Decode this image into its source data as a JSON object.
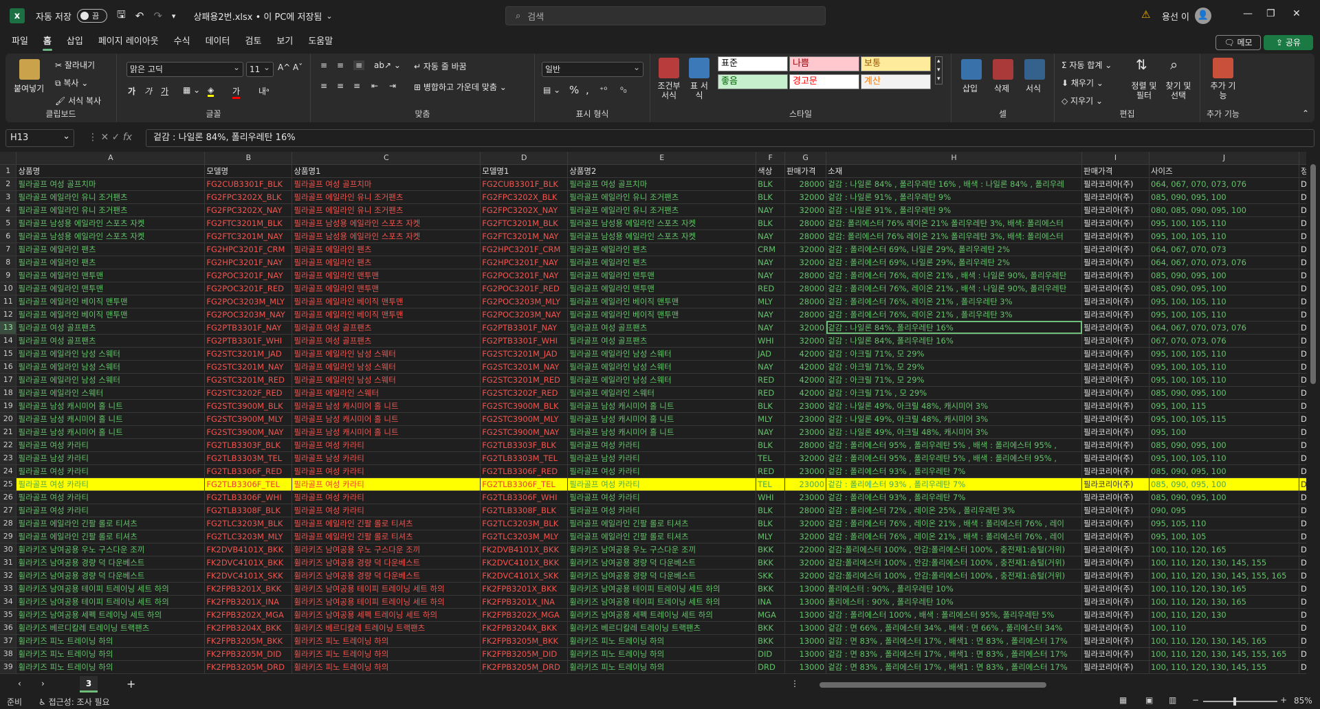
{
  "titlebar": {
    "autosave_label": "자동 저장",
    "autosave_state": "끔",
    "filename": "상패용2번.xlsx • 이 PC에 저장됨",
    "search_placeholder": "검색",
    "username": "용선 이"
  },
  "menu": {
    "tabs": [
      "파일",
      "홈",
      "삽입",
      "페이지 레이아웃",
      "수식",
      "데이터",
      "검토",
      "보기",
      "도움말"
    ],
    "active": "홈",
    "memo": "메모",
    "share": "공유"
  },
  "ribbon": {
    "clipboard": {
      "paste": "붙여넣기",
      "cut": "잘라내기",
      "copy": "복사",
      "format_painter": "서식 복사",
      "label": "클립보드"
    },
    "font": {
      "name": "맑은 고딕",
      "size": "11",
      "label": "글꼴"
    },
    "alignment": {
      "wrap": "자동 줄 바꿈",
      "merge": "병합하고 가운데 맞춤",
      "label": "맞춤"
    },
    "number": {
      "format": "일반",
      "label": "표시 형식"
    },
    "styles": {
      "conditional": "조건부 서식",
      "table": "표 서식",
      "cells": [
        "표준",
        "나쁨",
        "보통",
        "좋음",
        "경고문",
        "계산"
      ],
      "label": "스타일"
    },
    "cells": {
      "insert": "삽입",
      "delete": "삭제",
      "format": "서식",
      "label": "셀"
    },
    "editing": {
      "autosum": "자동 합계",
      "fill": "채우기",
      "clear": "지우기",
      "sort": "정렬 및 필터",
      "find": "찾기 및 선택",
      "label": "편집"
    },
    "addins": {
      "button": "추가 기능",
      "label": "추가 기능"
    }
  },
  "formula_bar": {
    "name_box": "H13",
    "formula": "겉감 : 나일론 84%, 폴리우레탄 16%"
  },
  "grid": {
    "columns": [
      "A",
      "B",
      "C",
      "D",
      "E",
      "F",
      "G",
      "H",
      "I",
      "J"
    ],
    "header_row": [
      "상품명",
      "모델명",
      "상품명1",
      "모델명1",
      "상품명2",
      "색상",
      "판매가격",
      "소재",
      "판매가격",
      "사이즈"
    ],
    "rows": [
      [
        "필라골프 여성 골프치마",
        "FG2CUB3301F_BLK",
        "필라골프 여성 골프치마",
        "FG2CUB3301F_BLK",
        "필라골프 여성 골프치마",
        "BLK",
        "28000",
        "겉감 : 나일론 84% , 폴리우레탄 16% , 배색 : 나일론 84% , 폴리우레",
        "필라코리아(주)",
        "064, 067, 070, 073, 076"
      ],
      [
        "필라골프 에일라인 유니 조거팬츠",
        "FG2FPC3202X_BLK",
        "필라골프 에일라인 유니 조거팬츠",
        "FG2FPC3202X_BLK",
        "필라골프 에일라인 유니 조거팬츠",
        "BLK",
        "32000",
        "겉감 : 나일론 91% , 폴리우레탄 9%",
        "필라코리아(주)",
        "085, 090, 095, 100"
      ],
      [
        "필라골프 에일라인 유니 조거팬츠",
        "FG2FPC3202X_NAY",
        "필라골프 에일라인 유니 조거팬츠",
        "FG2FPC3202X_NAY",
        "필라골프 에일라인 유니 조거팬츠",
        "NAY",
        "32000",
        "겉감 : 나일론 91% , 폴리우레탄 9%",
        "필라코리아(주)",
        "080, 085, 090, 095, 100"
      ],
      [
        "필라골프 남성용 에일라인 스포츠 자켓",
        "FG2FTC3201M_BLK",
        "필라골프 남성용 에일라인 스포츠 자켓",
        "FG2FTC3201M_BLK",
        "필라골프 남성용 에일라인 스포츠 자켓",
        "BLK",
        "28000",
        "겉감: 폴리에스터 76% 레이온 21% 폴리우레탄 3%, 배색: 폴리에스터",
        "필라코리아(주)",
        "095, 100, 105, 110"
      ],
      [
        "필라골프 남성용 에일라인 스포츠 자켓",
        "FG2FTC3201M_NAY",
        "필라골프 남성용 에일라인 스포츠 자켓",
        "FG2FTC3201M_NAY",
        "필라골프 남성용 에일라인 스포츠 자켓",
        "NAY",
        "28000",
        "겉감: 폴리에스터 76% 레이온 21% 폴리우레탄 3%, 배색: 폴리에스터",
        "필라코리아(주)",
        "095, 100, 105, 110"
      ],
      [
        "필라골프 에일라인 팬츠",
        "FG2HPC3201F_CRM",
        "필라골프 에일라인 팬츠",
        "FG2HPC3201F_CRM",
        "필라골프 에일라인 팬츠",
        "CRM",
        "32000",
        "겉감 : 폴리에스터 69%, 나일론 29%, 폴리우레탄 2%",
        "필라코리아(주)",
        "064, 067, 070, 073"
      ],
      [
        "필라골프 에일라인 팬츠",
        "FG2HPC3201F_NAY",
        "필라골프 에일라인 팬츠",
        "FG2HPC3201F_NAY",
        "필라골프 에일라인 팬츠",
        "NAY",
        "32000",
        "겉감 : 폴리에스터 69%, 나일론 29%, 폴리우레탄 2%",
        "필라코리아(주)",
        "064, 067, 070, 073, 076"
      ],
      [
        "필라골프 에일라인 맨투맨",
        "FG2POC3201F_NAY",
        "필라골프 에일라인 맨투맨",
        "FG2POC3201F_NAY",
        "필라골프 에일라인 맨투맨",
        "NAY",
        "28000",
        "겉감 : 폴리에스터 76%, 레이온 21% , 배색 : 나일론 90%, 폴리우레탄",
        "필라코리아(주)",
        "085, 090, 095, 100"
      ],
      [
        "필라골프 에일라인 맨투맨",
        "FG2POC3201F_RED",
        "필라골프 에일라인 맨투맨",
        "FG2POC3201F_RED",
        "필라골프 에일라인 맨투맨",
        "RED",
        "28000",
        "겉감 : 폴리에스터 76%, 레이온 21% , 배색 : 나일론 90%, 폴리우레탄",
        "필라코리아(주)",
        "085, 090, 095, 100"
      ],
      [
        "필라골프 에일라인 베이직 맨투맨",
        "FG2POC3203M_MLY",
        "필라골프 에일라인 베이직 맨투맨",
        "FG2POC3203M_MLY",
        "필라골프 에일라인 베이직 맨투맨",
        "MLY",
        "28000",
        "겉감 : 폴리에스터 76%, 레이온 21% , 폴리우레탄 3%",
        "필라코리아(주)",
        "095, 100, 105, 110"
      ],
      [
        "필라골프 에일라인 베이직 맨투맨",
        "FG2POC3203M_NAY",
        "필라골프 에일라인 베이직 맨투맨",
        "FG2POC3203M_NAY",
        "필라골프 에일라인 베이직 맨투맨",
        "NAY",
        "28000",
        "겉감 : 폴리에스터 76%, 레이온 21% , 폴리우레탄 3%",
        "필라코리아(주)",
        "095, 100, 105, 110"
      ],
      [
        "필라골프 여성 골프팬츠",
        "FG2PTB3301F_NAY",
        "필라골프 여성 골프팬츠",
        "FG2PTB3301F_NAY",
        "필라골프 여성 골프팬츠",
        "NAY",
        "32000",
        "겉감 : 나일론 84%, 폴리우레탄 16%",
        "필라코리아(주)",
        "064, 067, 070, 073, 076"
      ],
      [
        "필라골프 여성 골프팬츠",
        "FG2PTB3301F_WHI",
        "필라골프 여성 골프팬츠",
        "FG2PTB3301F_WHI",
        "필라골프 여성 골프팬츠",
        "WHI",
        "32000",
        "겉감 : 나일론 84%, 폴리우레탄 16%",
        "필라코리아(주)",
        "067, 070, 073, 076"
      ],
      [
        "필라골프 에일라인 남성 스웨터",
        "FG2STC3201M_JAD",
        "필라골프 에일라인 남성 스웨터",
        "FG2STC3201M_JAD",
        "필라골프 에일라인 남성 스웨터",
        "JAD",
        "42000",
        "겉감 : 아크릴 71%, 모 29%",
        "필라코리아(주)",
        "095, 100, 105, 110"
      ],
      [
        "필라골프 에일라인 남성 스웨터",
        "FG2STC3201M_NAY",
        "필라골프 에일라인 남성 스웨터",
        "FG2STC3201M_NAY",
        "필라골프 에일라인 남성 스웨터",
        "NAY",
        "42000",
        "겉감 : 아크릴 71%, 모 29%",
        "필라코리아(주)",
        "095, 100, 105, 110"
      ],
      [
        "필라골프 에일라인 남성 스웨터",
        "FG2STC3201M_RED",
        "필라골프 에일라인 남성 스웨터",
        "FG2STC3201M_RED",
        "필라골프 에일라인 남성 스웨터",
        "RED",
        "42000",
        "겉감 : 아크릴 71%, 모 29%",
        "필라코리아(주)",
        "095, 100, 105, 110"
      ],
      [
        "필라골프 에일라인 스웨터",
        "FG2STC3202F_RED",
        "필라골프 에일라인 스웨터",
        "FG2STC3202F_RED",
        "필라골프 에일라인 스웨터",
        "RED",
        "42000",
        "겉감 : 아크릴 71% , 모 29%",
        "필라코리아(주)",
        "085, 090, 095, 100"
      ],
      [
        "필라골프 남성 캐시미어 홀 니트",
        "FG2STC3900M_BLK",
        "필라골프 남성 캐시미어 홀 니트",
        "FG2STC3900M_BLK",
        "필라골프 남성 캐시미어 홀 니트",
        "BLK",
        "23000",
        "겉감 : 나일론 49%, 아크릴 48%, 캐시미어 3%",
        "필라코리아(주)",
        "095, 100, 115"
      ],
      [
        "필라골프 남성 캐시미어 홀 니트",
        "FG2STC3900M_MLY",
        "필라골프 남성 캐시미어 홀 니트",
        "FG2STC3900M_MLY",
        "필라골프 남성 캐시미어 홀 니트",
        "MLY",
        "23000",
        "겉감 : 나일론 49%, 아크릴 48%, 캐시미어 3%",
        "필라코리아(주)",
        "095, 100, 105, 115"
      ],
      [
        "필라골프 남성 캐시미어 홀 니트",
        "FG2STC3900M_NAY",
        "필라골프 남성 캐시미어 홀 니트",
        "FG2STC3900M_NAY",
        "필라골프 남성 캐시미어 홀 니트",
        "NAY",
        "23000",
        "겉감 : 나일론 49%, 아크릴 48%, 캐시미어 3%",
        "필라코리아(주)",
        "095, 100"
      ],
      [
        "필라골프 여성 카라티",
        "FG2TLB3303F_BLK",
        "필라골프 여성 카라티",
        "FG2TLB3303F_BLK",
        "필라골프 여성 카라티",
        "BLK",
        "28000",
        "겉감 : 폴리에스터 95% , 폴리우레탄 5% , 배색 : 폴리에스터 95% ,",
        "필라코리아(주)",
        "085, 090, 095, 100"
      ],
      [
        "필라골프 남성 카라티",
        "FG2TLB3303M_TEL",
        "필라골프 남성 카라티",
        "FG2TLB3303M_TEL",
        "필라골프 남성 카라티",
        "TEL",
        "32000",
        "겉감 : 폴리에스터 95% , 폴리우레탄 5% , 배색 : 폴리에스터 95% ,",
        "필라코리아(주)",
        "095, 100, 105, 110"
      ],
      [
        "필라골프 여성 카라티",
        "FG2TLB3306F_RED",
        "필라골프 여성 카라티",
        "FG2TLB3306F_RED",
        "필라골프 여성 카라티",
        "RED",
        "23000",
        "겉감 : 폴리에스터 93% , 폴리우레탄 7%",
        "필라코리아(주)",
        "085, 090, 095, 100"
      ],
      [
        "필라골프 여성 카라티",
        "FG2TLB3306F_TEL",
        "필라골프 여성 카라티",
        "FG2TLB3306F_TEL",
        "필라골프 여성 카라티",
        "TEL",
        "23000",
        "겉감 : 폴리에스터 93% , 폴리우레탄 7%",
        "필라코리아(주)",
        "085, 090, 095, 100"
      ],
      [
        "필라골프 여성 카라티",
        "FG2TLB3306F_WHI",
        "필라골프 여성 카라티",
        "FG2TLB3306F_WHI",
        "필라골프 여성 카라티",
        "WHI",
        "23000",
        "겉감 : 폴리에스터 93% , 폴리우레탄 7%",
        "필라코리아(주)",
        "085, 090, 095, 100"
      ],
      [
        "필라골프 여성 카라티",
        "FG2TLB3308F_BLK",
        "필라골프 여성 카라티",
        "FG2TLB3308F_BLK",
        "필라골프 여성 카라티",
        "BLK",
        "28000",
        "겉감 : 폴리에스터 72% , 레이온 25% , 폴리우레탄 3%",
        "필라코리아(주)",
        "090, 095"
      ],
      [
        "필라골프 에일라인 긴팔 롤로 티셔츠",
        "FG2TLC3203M_BLK",
        "필라골프 에일라인 긴팔 롤로 티셔츠",
        "FG2TLC3203M_BLK",
        "필라골프 에일라인 긴팔 롤로 티셔츠",
        "BLK",
        "32000",
        "겉감 : 폴리에스터 76% , 레이온 21% , 배색 : 폴리에스터 76% , 레이",
        "필라코리아(주)",
        "095, 105, 110"
      ],
      [
        "필라골프 에일라인 긴팔 롤로 티셔츠",
        "FG2TLC3203M_MLY",
        "필라골프 에일라인 긴팔 롤로 티셔츠",
        "FG2TLC3203M_MLY",
        "필라골프 에일라인 긴팔 롤로 티셔츠",
        "MLY",
        "32000",
        "겉감 : 폴리에스터 76% , 레이온 21% , 배색 : 폴리에스터 76% , 레이",
        "필라코리아(주)",
        "095, 100, 105"
      ],
      [
        "휠라키즈 남여공용 우노 구스다운 조끼",
        "FK2DVB4101X_BKK",
        "휠라키즈 남여공용 우노 구스다운 조끼",
        "FK2DVB4101X_BKK",
        "휠라키즈 남여공용 우노 구스다운 조끼",
        "BKK",
        "22000",
        "겉감:폴리에스터 100% , 안감:폴리에스터 100% , 충전재1:솜털(거위)",
        "필라코리아(주)",
        "100, 110, 120, 165"
      ],
      [
        "휠라키즈 남여공용 경량 덕 다운베스트",
        "FK2DVC4101X_BKK",
        "휠라키즈 남여공용 경량 덕 다운베스트",
        "FK2DVC4101X_BKK",
        "휠라키즈 남여공용 경량 덕 다운베스트",
        "BKK",
        "32000",
        "겉감:폴리에스터 100% , 안감:폴리에스터 100% , 충전재1:솜털(거위)",
        "필라코리아(주)",
        "100, 110, 120, 130, 145, 155"
      ],
      [
        "휠라키즈 남여공용 경량 덕 다운베스트",
        "FK2DVC4101X_SKK",
        "휠라키즈 남여공용 경량 덕 다운베스트",
        "FK2DVC4101X_SKK",
        "휠라키즈 남여공용 경량 덕 다운베스트",
        "SKK",
        "32000",
        "겉감:폴리에스터 100% , 안감:폴리에스터 100% , 충전재1:솜털(거위)",
        "필라코리아(주)",
        "100, 110, 120, 130, 145, 155, 165"
      ],
      [
        "휠라키즈 남여공용 테이피 트레이닝 세트 하의",
        "FK2FPB3201X_BKK",
        "휠라키즈 남여공용 테이피 트레이닝 세트 하의",
        "FK2FPB3201X_BKK",
        "휠라키즈 남여공용 테이피 트레이닝 세트 하의",
        "BKK",
        "13000",
        "폴리에스터 : 90% , 폴리우레탄 10%",
        "필라코리아(주)",
        "100, 110, 120, 130, 165"
      ],
      [
        "휠라키즈 남여공용 테이피 트레이닝 세트 하의",
        "FK2FPB3201X_INA",
        "휠라키즈 남여공용 테이피 트레이닝 세트 하의",
        "FK2FPB3201X_INA",
        "휠라키즈 남여공용 테이피 트레이닝 세트 하의",
        "INA",
        "13000",
        "폴리에스터 : 90% , 폴리우레탄 10%",
        "필라코리아(주)",
        "100, 110, 120, 130, 165"
      ],
      [
        "휠라키즈 남여공용 세펙 트레이닝 세트 하의",
        "FK2FPB3202X_MGA",
        "휠라키즈 남여공용 세펙 트레이닝 세트 하의",
        "FK2FPB3202X_MGA",
        "휠라키즈 남여공용 세펙 트레이닝 세트 하의",
        "MGA",
        "13000",
        "겉감 : 폴리에스터 100% , 배색 : 폴리에스터 95%, 폴리우레탄 5%",
        "필라코리아(주)",
        "100, 110, 120, 130"
      ],
      [
        "휠라키즈 베르디칼레 트레이닝 트랙팬츠",
        "FK2FPB3204X_BKK",
        "휠라키즈 베르디칼레 트레이닝 트랙팬츠",
        "FK2FPB3204X_BKK",
        "휠라키즈 베르디칼레 트레이닝 트랙팬츠",
        "BKK",
        "13000",
        "겉감 : 면 66% , 폴리에스터 34% , 배색 : 면 66% , 폴리에스터 34%",
        "필라코리아(주)",
        "100, 110"
      ],
      [
        "휠라키즈 피노 트레이닝 하의",
        "FK2FPB3205M_BKK",
        "휠라키즈 피노 트레이닝 하의",
        "FK2FPB3205M_BKK",
        "휠라키즈 피노 트레이닝 하의",
        "BKK",
        "13000",
        "겉감 : 면 83% , 폴리에스터 17% , 배색1 : 면 83% , 폴리에스터 17%",
        "필라코리아(주)",
        "100, 110, 120, 130, 145, 165"
      ],
      [
        "휠라키즈 피노 트레이닝 하의",
        "FK2FPB3205M_DID",
        "휠라키즈 피노 트레이닝 하의",
        "FK2FPB3205M_DID",
        "휠라키즈 피노 트레이닝 하의",
        "DID",
        "13000",
        "겉감 : 면 83% , 폴리에스터 17% , 배색1 : 면 83% , 폴리에스터 17%",
        "필라코리아(주)",
        "100, 110, 120, 130, 145, 155, 165"
      ],
      [
        "휠라키즈 피노 트레이닝 하의",
        "FK2FPB3205M_DRD",
        "휠라키즈 피노 트레이닝 하의",
        "FK2FPB3205M_DRD",
        "휠라키즈 피노 트레이닝 하의",
        "DRD",
        "13000",
        "겉감 : 면 83% , 폴리에스터 17% , 배색1 : 면 83% , 폴리에스터 17%",
        "필라코리아(주)",
        "100, 110, 120, 130, 145, 155"
      ]
    ],
    "highlighted_row": 25,
    "selected_row": 13,
    "row_numbers_start": 1
  },
  "sheets": {
    "tabs": [
      "3"
    ],
    "active": "3"
  },
  "status": {
    "ready": "준비",
    "accessibility": "접근성: 조사 필요",
    "zoom": "85%"
  },
  "colors": {
    "accent": "#1b7a43",
    "highlight": "#ffff00",
    "green_text": "#63c36a",
    "red_text": "#f0554f"
  }
}
